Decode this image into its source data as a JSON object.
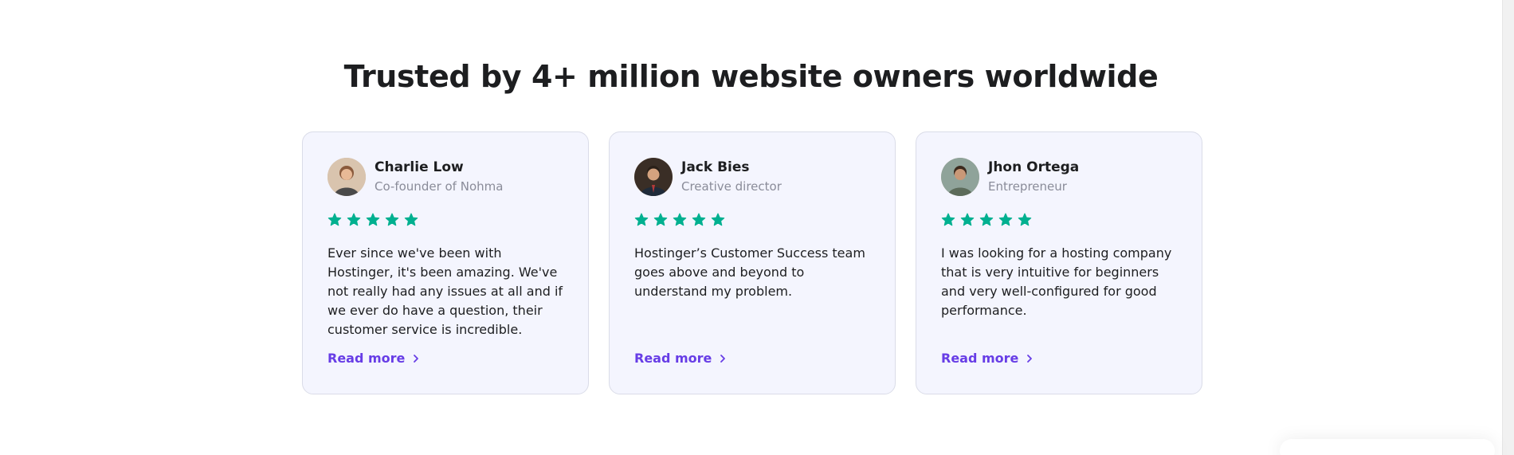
{
  "section": {
    "title": "Trusted by 4+ million website owners worldwide"
  },
  "colors": {
    "star": "#00b090",
    "link": "#673de6",
    "card_bg": "#f4f5fe"
  },
  "testimonials": [
    {
      "name": "Charlie Low",
      "role": "Co-founder of Nohma",
      "rating": 5,
      "quote": "Ever since we've been with Hostinger, it's been amazing. We've not really had any issues at all and if we ever do have a question, their customer service is incredible.",
      "link_label": "Read more",
      "avatar_icon": "person-avatar"
    },
    {
      "name": "Jack Bies",
      "role": "Creative director",
      "rating": 5,
      "quote": "Hostinger’s Customer Success team goes above and beyond to understand my problem.",
      "link_label": "Read more",
      "avatar_icon": "person-avatar"
    },
    {
      "name": "Jhon Ortega",
      "role": "Entrepreneur",
      "rating": 5,
      "quote": "I was looking for a hosting company that is very intuitive for beginners and very well-configured for good performance.",
      "link_label": "Read more",
      "avatar_icon": "person-avatar"
    }
  ]
}
